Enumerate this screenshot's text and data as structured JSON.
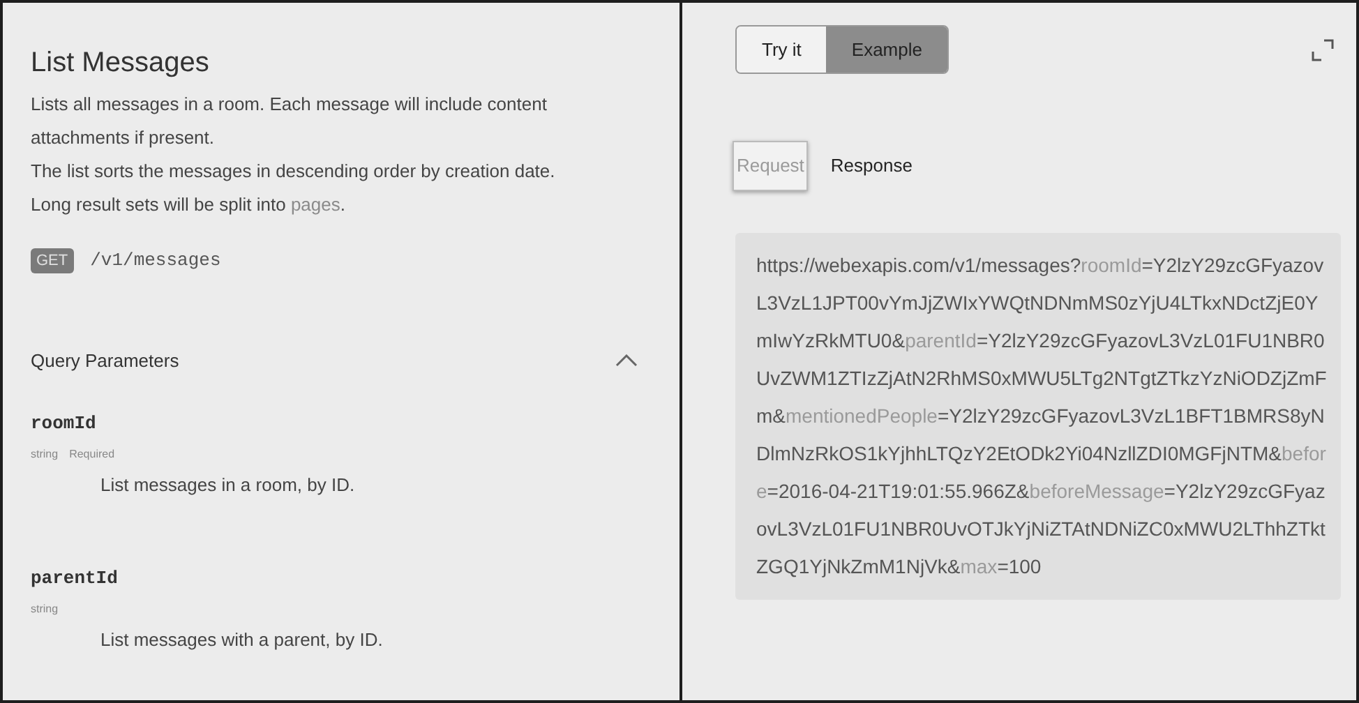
{
  "title": "List Messages",
  "description": [
    {
      "text": "Lists all messages in a room. Each message will include content attachments if present."
    },
    {
      "text": "The list sorts the messages in descending order by creation date."
    },
    {
      "text": "Long result sets will be split into ",
      "link": "pages",
      "after": "."
    }
  ],
  "endpoint": {
    "method": "GET",
    "path": "/v1/messages"
  },
  "query_parameters": {
    "title": "Query Parameters",
    "expanded": true,
    "params": [
      {
        "name": "roomId",
        "type": "string",
        "required": "Required",
        "description": "List messages in a room, by ID."
      },
      {
        "name": "parentId",
        "type": "string",
        "description": "List messages with a parent, by ID."
      }
    ]
  },
  "mode_tabs": [
    {
      "label": "Try it",
      "selected": false
    },
    {
      "label": "Example",
      "selected": true
    }
  ],
  "sub_tabs": [
    {
      "label": "Request",
      "selected": true
    },
    {
      "label": "Response",
      "selected": false
    }
  ],
  "request_url": [
    {
      "kind": "base",
      "text": "https://webexapis.com/v1/messages?"
    },
    {
      "kind": "param",
      "text": "roomId"
    },
    {
      "kind": "value",
      "text": "=Y2lzY29zcGFyazovL3VzL1JPT00vYmJjZWIxYWQtNDNmMS0zYjU4LTkxNDctZjE0YmIwYzRkMTU0&"
    },
    {
      "kind": "param",
      "text": "parentId"
    },
    {
      "kind": "value",
      "text": "=Y2lzY29zcGFyazovL3VzL01FU1NBR0UvZWM1ZTIzZjAtN2RhMS0xMWU5LTg2NTgtZTkzYzNiODZjZmFm&"
    },
    {
      "kind": "param",
      "text": "mentionedPeople"
    },
    {
      "kind": "value",
      "text": "=Y2lzY29zcGFyazovL3VzL1BFT1BMRS8yNDlmNzRkOS1kYjhhLTQzY2EtODk2Yi04NzllZDI0MGFjNTM&"
    },
    {
      "kind": "param",
      "text": "before"
    },
    {
      "kind": "value",
      "text": "=2016-04-21T19:01:55.966Z&"
    },
    {
      "kind": "param",
      "text": "beforeMessage"
    },
    {
      "kind": "value",
      "text": "=Y2lzY29zcGFyazovL3VzL01FU1NBR0UvOTJkYjNiZTAtNDNiZC0xMWU2LThhZTktZGQ1YjNkZmM1NjVk&"
    },
    {
      "kind": "param",
      "text": "max"
    },
    {
      "kind": "value",
      "text": "=100"
    }
  ]
}
